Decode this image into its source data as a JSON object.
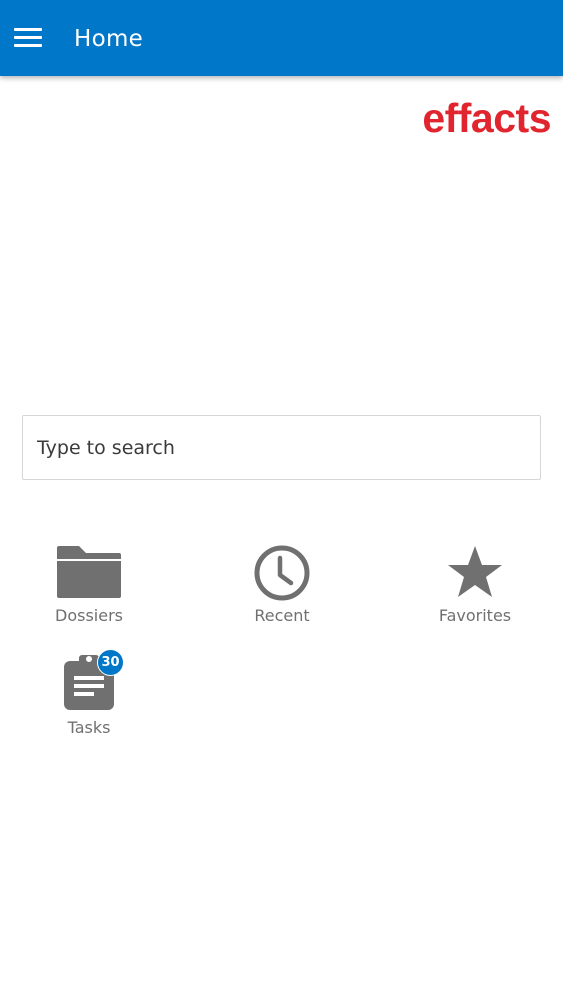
{
  "header": {
    "title": "Home",
    "menu_icon": "hamburger-menu-icon",
    "background": "#0077c8"
  },
  "brand": {
    "logo_text": "effacts",
    "logo_color": "#e0252e"
  },
  "search": {
    "placeholder": "Type to search"
  },
  "tiles": [
    {
      "label": "Dossiers",
      "icon": "folder-icon"
    },
    {
      "label": "Recent",
      "icon": "clock-icon"
    },
    {
      "label": "Favorites",
      "icon": "star-icon"
    },
    {
      "label": "Tasks",
      "icon": "clipboard-icon",
      "badge": "30"
    }
  ],
  "colors": {
    "icon": "#707070",
    "accent": "#0077c8"
  }
}
